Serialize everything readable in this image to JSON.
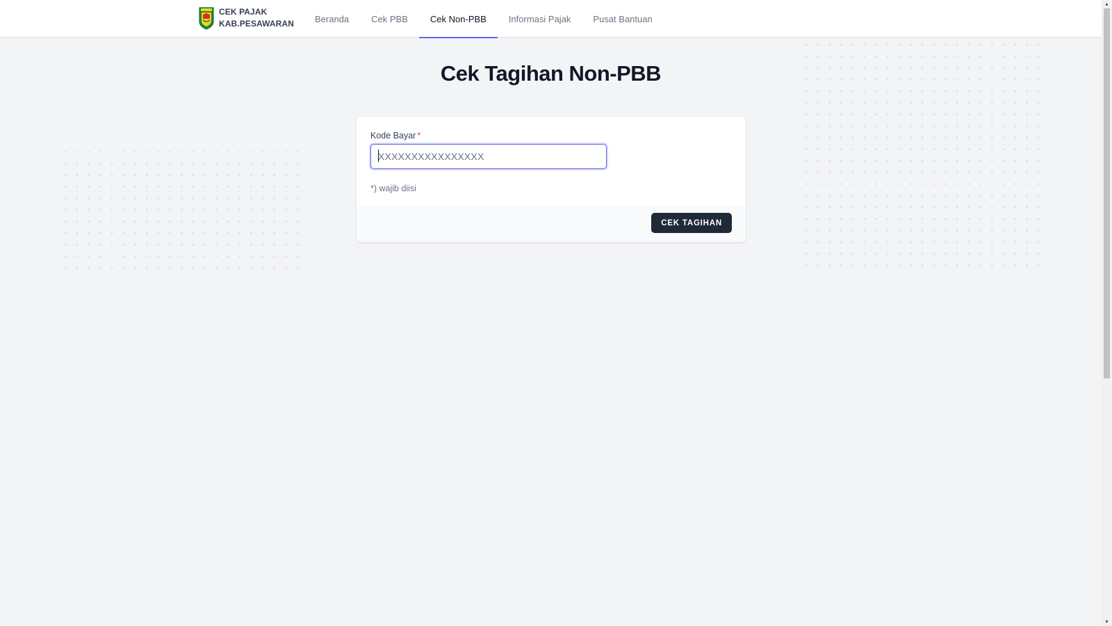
{
  "header": {
    "brand": {
      "line1": "CEK PAJAK",
      "line2": "KAB.PESAWARAN",
      "logo_icon": "regency-crest-icon"
    },
    "nav": [
      {
        "label": "Beranda",
        "active": false
      },
      {
        "label": "Cek PBB",
        "active": false
      },
      {
        "label": "Cek Non-PBB",
        "active": true
      },
      {
        "label": "Informasi Pajak",
        "active": false
      },
      {
        "label": "Pusat Bantuan",
        "active": false
      }
    ]
  },
  "main": {
    "title": "Cek Tagihan Non-PBB",
    "form": {
      "field_label": "Kode Bayar",
      "required_mark": "*",
      "input_value": "",
      "input_placeholder": "XXXXXXXXXXXXXXXX",
      "hint": "*) wajib diisi",
      "submit_label": "CEK TAGIHAN"
    }
  },
  "colors": {
    "accent": "#6366f1",
    "button_bg": "#1f2937",
    "required": "#ef4444",
    "page_bg": "#f3f4f6"
  }
}
